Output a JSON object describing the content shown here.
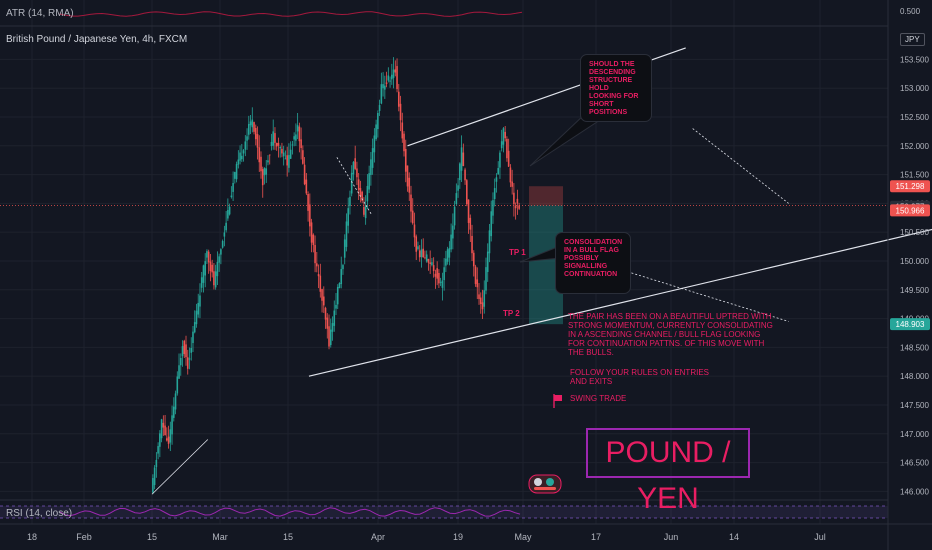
{
  "indicators": {
    "atr_label": "ATR (14, RMA)",
    "atr_value": "0.500",
    "rsi_label": "RSI (14, close)"
  },
  "symbol": {
    "title": "British Pound / Japanese Yen, 4h, FXCM",
    "currency": "JPY"
  },
  "annotations": {
    "callout_top": "SHOULD THE DESCENDING STRUCTURE HOLD LOOKING FOR SHORT POSITIONS",
    "callout_mid": "CONSOLIDATION IN A BULL FLAG POSSIBLY SIGNALLING CONTINUATION",
    "note_main": "THE PAIR HAS BEEN ON A BEAUTIFUL UPTRED WITH STRONG MOMENTUM, CURRENTLY CONSOLIDATING IN A ASCENDING CHANNEL / BULL FLAG LOOKING FOR CONTINUATION PATTNS. OF THIS MOVE WITH THE BULLS.",
    "note_rules": "FOLLOW YOUR RULES ON ENTRIES AND EXITS",
    "note_swing": "SWING TRADE",
    "banner": "POUND / YEN",
    "tp1": "TP 1",
    "tp2": "TP 2"
  },
  "colors": {
    "background": "#131722",
    "up": "#26a69a",
    "down": "#ef5350",
    "accent": "#e91e63",
    "banner_border": "#9c27b0",
    "grid": "#1e222d",
    "trendline": "#e0e3eb",
    "stop_zone": "rgba(239,83,80,0.28)",
    "target_zone": "rgba(38,166,154,0.35)"
  },
  "chart_data": {
    "type": "candlestick",
    "symbol": "GBPJPY",
    "timeframe": "4h",
    "y_ticks": [
      "153.500",
      "153.000",
      "152.500",
      "152.000",
      "151.500",
      "151.000",
      "150.500",
      "150.000",
      "149.500",
      "149.000",
      "148.500",
      "148.000",
      "147.500",
      "147.000",
      "146.500",
      "146.000"
    ],
    "x_ticks": [
      "18",
      "Feb",
      "15",
      "Mar",
      "15",
      "Apr",
      "19",
      "May",
      "17",
      "Jun",
      "14",
      "Jul"
    ],
    "ylim": [
      145.85,
      153.75
    ],
    "price_labels": [
      {
        "value": "151.298",
        "style": "red"
      },
      {
        "value": "150.977",
        "style": "grey"
      },
      {
        "value": "150.966",
        "style": "red"
      },
      {
        "value": "148.903",
        "style": "green"
      }
    ],
    "current_price": 150.966,
    "swing_points": [
      {
        "t": 0,
        "p": 145.95
      },
      {
        "t": 6,
        "p": 147.2
      },
      {
        "t": 10,
        "p": 146.8
      },
      {
        "t": 18,
        "p": 148.6
      },
      {
        "t": 21,
        "p": 148.2
      },
      {
        "t": 32,
        "p": 150.2
      },
      {
        "t": 36,
        "p": 149.6
      },
      {
        "t": 48,
        "p": 151.5
      },
      {
        "t": 58,
        "p": 152.5
      },
      {
        "t": 64,
        "p": 151.4
      },
      {
        "t": 70,
        "p": 152.2
      },
      {
        "t": 78,
        "p": 151.7
      },
      {
        "t": 84,
        "p": 152.4
      },
      {
        "t": 92,
        "p": 150.4
      },
      {
        "t": 102,
        "p": 148.6
      },
      {
        "t": 110,
        "p": 150.0
      },
      {
        "t": 116,
        "p": 151.8
      },
      {
        "t": 122,
        "p": 150.8
      },
      {
        "t": 132,
        "p": 153.0
      },
      {
        "t": 140,
        "p": 153.3
      },
      {
        "t": 146,
        "p": 151.6
      },
      {
        "t": 152,
        "p": 150.2
      },
      {
        "t": 160,
        "p": 150.0
      },
      {
        "t": 166,
        "p": 149.6
      },
      {
        "t": 172,
        "p": 150.4
      },
      {
        "t": 178,
        "p": 151.9
      },
      {
        "t": 186,
        "p": 149.6
      },
      {
        "t": 190,
        "p": 149.2
      },
      {
        "t": 196,
        "p": 151.1
      },
      {
        "t": 202,
        "p": 152.3
      },
      {
        "t": 208,
        "p": 151.0
      },
      {
        "t": 211,
        "p": 150.97
      }
    ],
    "trendlines": [
      {
        "name": "upper-channel",
        "from": [
          146.5,
          152.0
        ],
        "to": [
          306,
          153.7
        ]
      },
      {
        "name": "lower-channel",
        "from": [
          90,
          148.0
        ],
        "to": [
          553,
          151.3
        ]
      },
      {
        "name": "flag-upper",
        "from": [
          310,
          152.3
        ],
        "to": [
          365,
          151.0
        ]
      },
      {
        "name": "flag-lower",
        "from": [
          242,
          150.1
        ],
        "to": [
          365,
          148.95
        ]
      }
    ],
    "position": {
      "type": "short",
      "stop_top": 151.298,
      "entry": 150.966,
      "target_1": 150.0,
      "target_2": 148.903
    }
  }
}
